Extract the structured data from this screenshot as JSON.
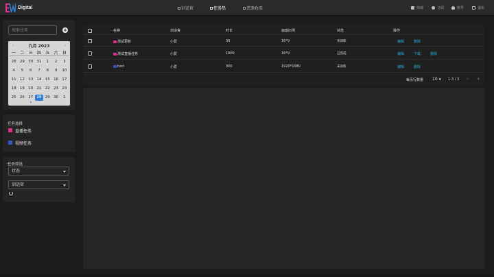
{
  "app": {
    "name": "Digital",
    "colors": {
      "logo_pink": "#e0308a",
      "logo_blue": "#2f7fd0",
      "accent": "#2aa8d8"
    }
  },
  "nav": [
    {
      "label": "训话官",
      "icon": "grid-icon"
    },
    {
      "label": "任务热",
      "icon": "list-icon",
      "active": true
    },
    {
      "label": "资源仓库",
      "icon": "home-icon"
    }
  ],
  "header_right": [
    {
      "label": "商城",
      "icon": "apps-icon"
    },
    {
      "label": "订阅",
      "icon": "chat-icon"
    },
    {
      "label": "账号",
      "icon": "user-icon"
    },
    {
      "label": "退出",
      "icon": "logout-icon"
    }
  ],
  "sidebar": {
    "search_placeholder": "搜索任务",
    "calendar": {
      "title": "九月 2023",
      "weekdays": [
        "一",
        "二",
        "三",
        "四",
        "五",
        "六",
        "日"
      ],
      "days": [
        "28",
        "29",
        "30",
        "31",
        "1",
        "2",
        "3",
        "4",
        "5",
        "6",
        "7",
        "8",
        "9",
        "10",
        "11",
        "12",
        "13",
        "14",
        "15",
        "16",
        "17",
        "18",
        "19",
        "20",
        "21",
        "22",
        "23",
        "24",
        "25",
        "26",
        "27",
        "28",
        "29",
        "30",
        "1"
      ],
      "today_index": 31,
      "dot_index": 30
    },
    "task_select": {
      "title": "任务选择",
      "options": [
        {
          "label": "直播任务",
          "color": "#e0308a"
        },
        {
          "label": "视频任务",
          "color": "#2f55c8"
        }
      ]
    },
    "filter": {
      "title": "任务筛选",
      "status_placeholder": "状态",
      "officer_placeholder": "训话官"
    }
  },
  "table": {
    "headers": [
      "名称",
      "训话官",
      "时长",
      "画面比例",
      "状态",
      "操作"
    ],
    "rows": [
      {
        "name": "测试更新",
        "tag_color": "#e0308a",
        "officer": "小爱",
        "duration": "30",
        "ratio": "16*9",
        "status": "未训练",
        "actions": [
          "编辑",
          "删除"
        ]
      },
      {
        "name": "测试直播任务",
        "tag_color": "#e0308a",
        "officer": "小爱",
        "duration": "1800",
        "ratio": "16*9",
        "status": "已完成",
        "actions": [
          "编辑",
          "下载",
          "删除"
        ]
      },
      {
        "name": "test",
        "tag_color": "#2f55c8",
        "officer": "小爱",
        "duration": "300",
        "ratio": "1920*1080",
        "status": "未训练",
        "actions": [
          "编辑",
          "删除"
        ]
      }
    ],
    "pager": {
      "label": "每页行数量",
      "page_size": "10",
      "range": "1-3 / 3"
    }
  }
}
